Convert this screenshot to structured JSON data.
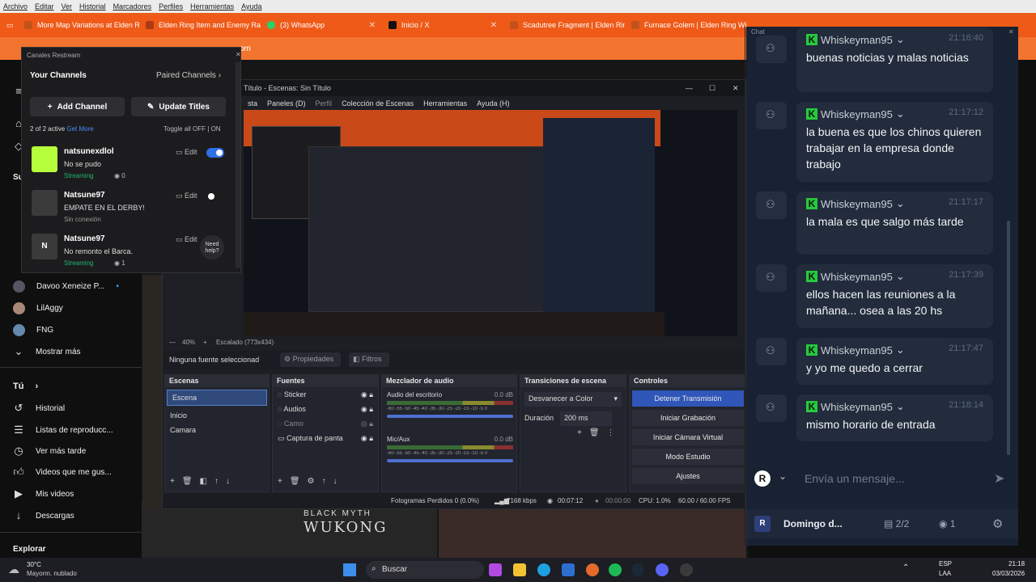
{
  "firefox_menu": [
    "Archivo",
    "Editar",
    "Ver",
    "Historial",
    "Marcadores",
    "Perfiles",
    "Herramientas",
    "Ayuda"
  ],
  "tabs": [
    {
      "label": "More Map Variations at Elden R",
      "color": "#c3521a"
    },
    {
      "label": "Elden Ring Item and Enemy Ra",
      "color": "#ae3a15"
    },
    {
      "label": "(3) WhatsApp",
      "color": "#25d366"
    },
    {
      "label": "Inicio / X",
      "color": "#111111"
    },
    {
      "label": "Scadutree Fragment | Elden Rin",
      "color": "#c3521a"
    },
    {
      "label": "Furnace Golem | Elden Ring Wi",
      "color": "#c3521a"
    }
  ],
  "url_fragment": "om",
  "youtube": {
    "subs_header": "Su",
    "channels": [
      "Davoo Xeneize P...",
      "LilAggy",
      "FNG"
    ],
    "show_more": "Mostrar más",
    "you_header": "Tú",
    "you_items": [
      "Historial",
      "Listas de reproducc...",
      "Ver más tarde",
      "Videos que me gus...",
      "Mis videos",
      "Descargas"
    ],
    "explore": "Explorar"
  },
  "restream": {
    "title": "Canales Restream",
    "your_channels": "Your Channels",
    "paired": "Paired Channels",
    "add_channel": "Add Channel",
    "update_titles": "Update Titles",
    "active": "2 of 2 active",
    "get_more": "Get More",
    "toggle_all": "Toggle all OFF",
    "on": "ON",
    "edit": "Edit",
    "need_help": "Need help?",
    "channels": [
      {
        "name": "natsunexdlol",
        "title": "No se pudo",
        "status": "Streaming",
        "viewers": "0",
        "on": true
      },
      {
        "name": "Natsune97",
        "title": "EMPATE EN EL DERBY!",
        "status": "Sin conexión",
        "viewers": "",
        "on": false
      },
      {
        "name": "Natsune97",
        "title": "No remonto el Barca.",
        "status": "Streaming",
        "viewers": "1",
        "on": true
      }
    ]
  },
  "obs": {
    "title": "Título - Escenas: Sin Título",
    "menu": [
      "sta",
      "Paneles (D)",
      "Perfil",
      "Colección de Escenas",
      "Herramientas",
      "Ayuda (H)"
    ],
    "zoom": "40%",
    "scale": "Escalado (773x434)",
    "no_source": "Ninguna fuente seleccionad",
    "properties": "Propiedades",
    "filters": "Filtros",
    "scenes_title": "Escenas",
    "scenes": [
      "Escena",
      "Inicio",
      "Camara"
    ],
    "sources_title": "Fuentes",
    "sources": [
      "Sticker",
      "Audios",
      "Camo",
      "Captura de panta"
    ],
    "mixer_title": "Mezclador de audio",
    "mixer": [
      {
        "name": "Audio del escritorio",
        "db": "0.0 dB"
      },
      {
        "name": "Mic/Aux",
        "db": "0.0 dB"
      }
    ],
    "meter_ticks": "-60 -55 -50 -45 -40 -35 -30 -25 -20 -15 -10 -5 0",
    "transitions_title": "Transiciones de escena",
    "transition": "Desvanecer a Color",
    "duration_label": "Duración",
    "duration": "200 ms",
    "controls_title": "Controles",
    "controls": [
      "Detener Transmisión",
      "Iniciar Grabación",
      "Iniciar Cámara Virtual",
      "Modo Estudio",
      "Ajustes"
    ],
    "status": {
      "dropped": "Fotogramas Perdidos 0 (0.0%)",
      "kbps": "7168 kbps",
      "live": "00:07:12",
      "rec": "00:00:00",
      "cpu": "CPU: 1.0%",
      "fps": "60.00 / 60.00 FPS"
    }
  },
  "chat": {
    "header": "Chat",
    "messages": [
      {
        "user": "Whiskeyman95",
        "time": "21:16:40",
        "text": "buenas noticias y malas noticias"
      },
      {
        "user": "Whiskeyman95",
        "time": "21:17:12",
        "text": "la buena es que los chinos quieren trabajar en la empresa donde trabajo"
      },
      {
        "user": "Whiskeyman95",
        "time": "21:17:17",
        "text": "la mala es que salgo más tarde"
      },
      {
        "user": "Whiskeyman95",
        "time": "21:17:39",
        "text": "ellos hacen las reuniones a la mañana... osea a las 20 hs"
      },
      {
        "user": "Whiskeyman95",
        "time": "21:17:47",
        "text": "y yo me quedo a cerrar"
      },
      {
        "user": "Whiskeyman95",
        "time": "21:18:14",
        "text": "mismo horario de entrada"
      }
    ],
    "input_placeholder": "Envía un mensaje...",
    "footer_name": "Domingo d...",
    "footer_platforms": "2/2",
    "footer_viewers": "1"
  },
  "background": {
    "game_title": "BLACK MYTH",
    "game_subtitle": "WUKONG"
  },
  "taskbar": {
    "weather_temp": "30°C",
    "weather_desc": "Mayorm. nublado",
    "search": "Buscar",
    "lang": "ESP",
    "lang2": "LAA",
    "time": "21:18",
    "date": "03/03/2026"
  }
}
